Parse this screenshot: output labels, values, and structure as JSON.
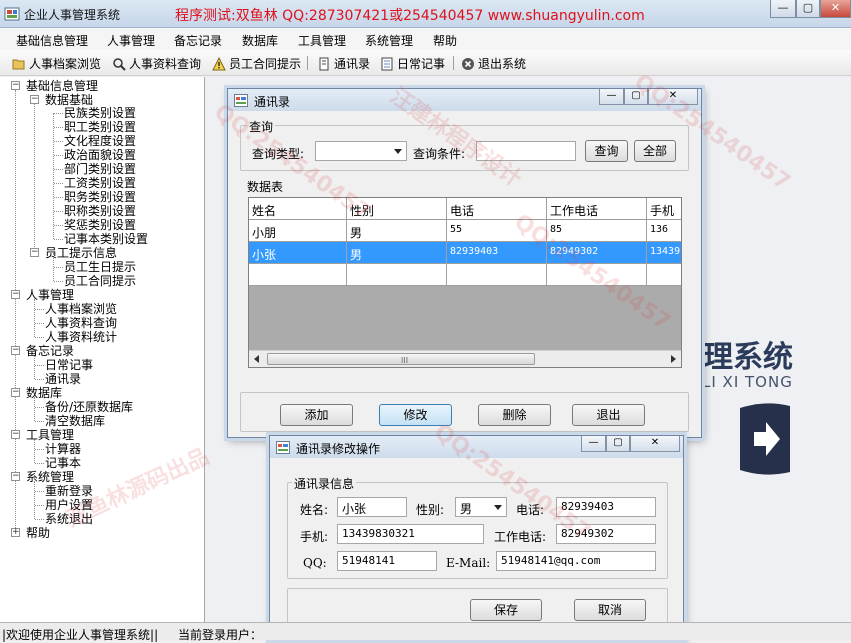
{
  "app": {
    "title": "企业人事管理系统",
    "banner": "程序测试:双鱼林 QQ:287307421或254540457 www.shuangyulin.com",
    "minimize": "—",
    "restore": "▢",
    "close": "✕"
  },
  "menu": [
    "基础信息管理",
    "人事管理",
    "备忘记录",
    "数据库",
    "工具管理",
    "系统管理",
    "帮助"
  ],
  "toolbar": [
    "人事档案浏览",
    "人事资料查询",
    "员工合同提示",
    "通讯录",
    "日常记事",
    "退出系统"
  ],
  "tree": {
    "root1": "基础信息管理",
    "data_basic": "数据基础",
    "basic_items": [
      "民族类别设置",
      "职工类别设置",
      "文化程度设置",
      "政治面貌设置",
      "部门类别设置",
      "工资类别设置",
      "职务类别设置",
      "职称类别设置",
      "奖惩类别设置",
      "记事本类别设置"
    ],
    "reminder": "员工提示信息",
    "reminder_items": [
      "员工生日提示",
      "员工合同提示"
    ],
    "hr": "人事管理",
    "hr_items": [
      "人事档案浏览",
      "人事资料查询",
      "人事资料统计"
    ],
    "memo": "备忘记录",
    "memo_items": [
      "日常记事",
      "通讯录"
    ],
    "db": "数据库",
    "db_items": [
      "备份/还原数据库",
      "清空数据库"
    ],
    "tools": "工具管理",
    "tools_items": [
      "计算器",
      "记事本"
    ],
    "sys": "系统管理",
    "sys_items": [
      "重新登录",
      "用户设置",
      "系统退出"
    ],
    "help": "帮助"
  },
  "logo": {
    "text": "理系统",
    "sub": "LI XI TONG"
  },
  "status": {
    "welcome": "|欢迎使用企业人事管理系统||",
    "user": "当前登录用户："
  },
  "contacts_window": {
    "title": "通讯录",
    "query_group": "查询",
    "query_type_label": "查询类型:",
    "query_type_value": "",
    "query_cond_label": "查询条件:",
    "query_cond_value": "",
    "query_button": "查询",
    "all_button": "全部",
    "table_group": "数据表",
    "columns": [
      "姓名",
      "性别",
      "电话",
      "工作电话",
      "手机"
    ],
    "rows": [
      [
        "小朋",
        "男",
        "55",
        "85",
        "136"
      ],
      [
        "小张",
        "男",
        "82939403",
        "82949302",
        "13439"
      ]
    ],
    "grip": "III",
    "buttons": {
      "add": "添加",
      "edit": "修改",
      "delete": "删除",
      "exit": "退出"
    }
  },
  "edit_window": {
    "title": "通讯录修改操作",
    "group": "通讯录信息",
    "name_label": "姓名:",
    "name_value": "小张",
    "gender_label": "性别:",
    "gender_value": "男",
    "phone_label": "电话:",
    "phone_value": "82939403",
    "mobile_label": "手机:",
    "mobile_value": "13439830321",
    "work_phone_label": "工作电话:",
    "work_phone_value": "82949302",
    "qq_label": "QQ:",
    "qq_value": "51948141",
    "email_label": "E-Mail:",
    "email_value": "51948141@qq.com",
    "save_button": "保存",
    "cancel_button": "取消"
  },
  "watermarks": [
    "QQ:254540457",
    "汪建林程序设计",
    "双鱼林源码出品"
  ]
}
